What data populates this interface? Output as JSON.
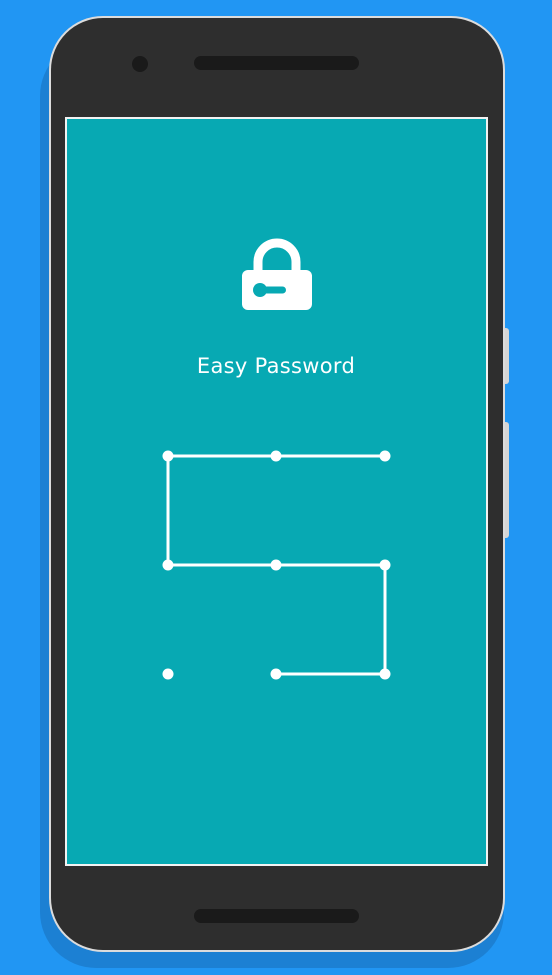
{
  "app": {
    "title": "Easy Password"
  },
  "icons": {
    "lock": "lock-icon",
    "camera": "front-camera",
    "speaker": "earpiece-speaker"
  },
  "colors": {
    "background": "#2196F3",
    "screen": "#07A9B3",
    "device": "#2e2e2e",
    "pattern": "#ffffff"
  },
  "pattern": {
    "grid": "3x3",
    "sequence": [
      3,
      2,
      1,
      4,
      5,
      6,
      9,
      8
    ],
    "unused_nodes": [
      7
    ]
  }
}
